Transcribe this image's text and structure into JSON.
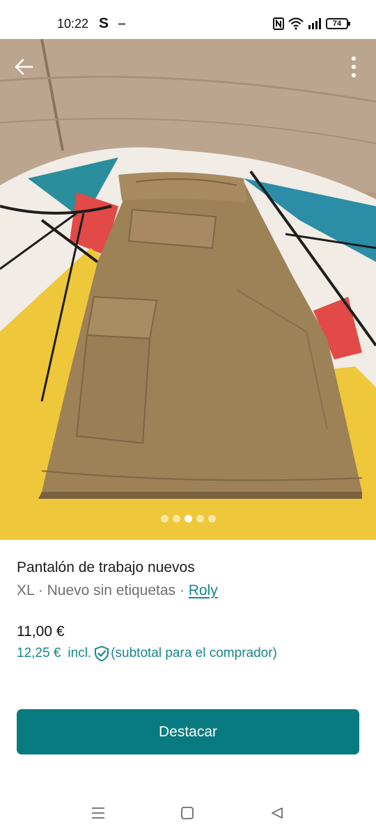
{
  "status_bar": {
    "time": "10:22",
    "app_indicator": "S",
    "battery": "74",
    "icons": [
      "nfc-icon",
      "wifi-icon",
      "signal-icon",
      "battery-icon"
    ]
  },
  "gallery": {
    "image_count": 5,
    "active_index": 2,
    "icons": {
      "back": "arrow-left-icon",
      "more": "more-vertical-icon"
    }
  },
  "listing": {
    "title": "Pantalón de trabajo nuevos",
    "size": "XL",
    "condition": "Nuevo sin etiquetas",
    "separator": " · ",
    "brand": "Roly",
    "price": "11,00 €",
    "price_incl": "12,25 €",
    "incl_label": "incl.",
    "incl_note": "(subtotal para el comprador)"
  },
  "actions": {
    "promote_label": "Destacar"
  },
  "nav_bar": {
    "icons": [
      "menu-icon",
      "home-square-icon",
      "back-triangle-icon"
    ]
  },
  "colors": {
    "accent": "#087b80",
    "link": "#16868c",
    "text_secondary": "#6f6f6f"
  }
}
